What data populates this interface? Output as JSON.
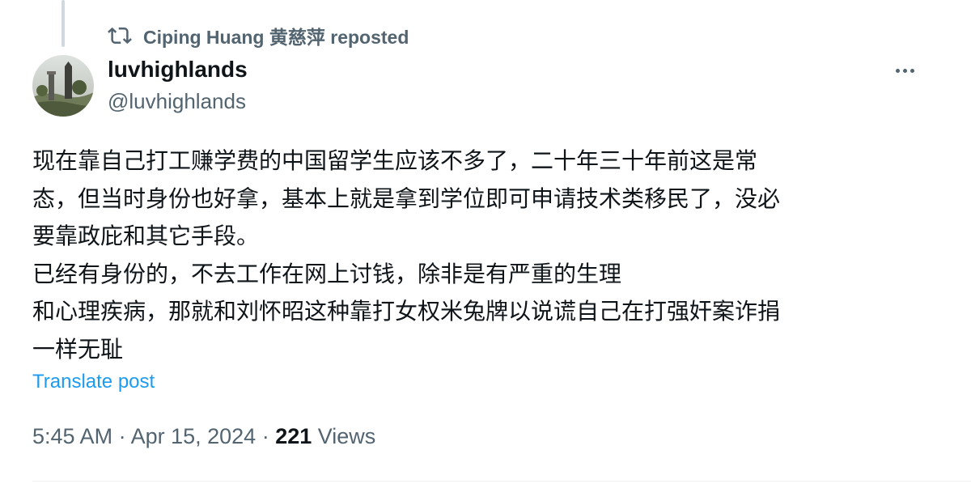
{
  "repost": {
    "reposter": "Ciping Huang 黄慈萍 reposted",
    "icon": "repost-icon"
  },
  "author": {
    "display_name": "luvhighlands",
    "handle": "@luvhighlands",
    "avatar": "landscape-avatar"
  },
  "post": {
    "lines": [
      "现在靠自己打工赚学费的中国留学生应该不多了，二十年三十年前这是常",
      "态，但当时身份也好拿，基本上就是拿到学位即可申请技术类移民了，没必",
      "要靠政庇和其它手段。",
      "已经有身份的，不去工作在网上讨钱，除非是有严重的生理",
      "和心理疾病，那就和刘怀昭这种靠打女权米兔牌以说谎自己在打强奸案诈捐",
      "一样无耻"
    ],
    "translate_label": "Translate post"
  },
  "meta": {
    "time": "5:45 AM",
    "separator": " · ",
    "date": "Apr 15, 2024",
    "views_count": "221",
    "views_label": " Views"
  },
  "colors": {
    "text": "#0f1419",
    "secondary": "#536471",
    "link": "#1d9bf0",
    "thread_line": "#cfd9de"
  }
}
